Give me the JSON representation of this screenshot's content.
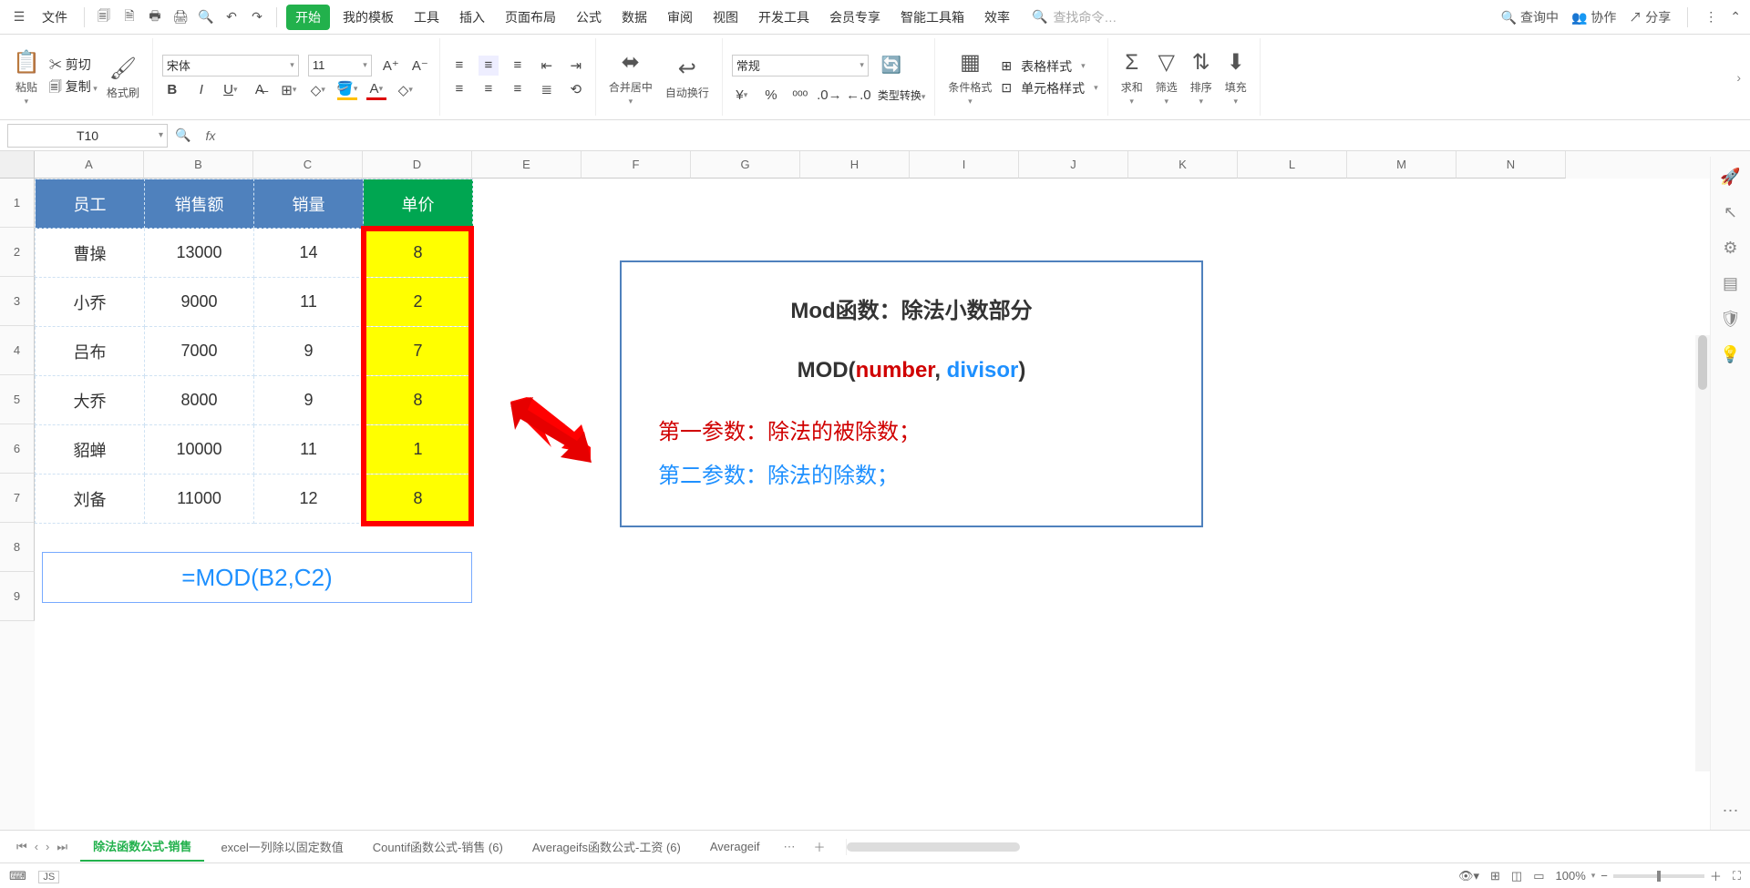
{
  "menu": {
    "file": "文件",
    "tabs": [
      "开始",
      "我的模板",
      "工具",
      "插入",
      "页面布局",
      "公式",
      "数据",
      "审阅",
      "视图",
      "开发工具",
      "会员专享",
      "智能工具箱",
      "效率"
    ],
    "search_placeholder": "查找命令…",
    "right": {
      "query": "查询中",
      "collab": "协作",
      "share": "分享"
    }
  },
  "ribbon": {
    "paste": "粘贴",
    "cut": "剪切",
    "copy": "复制",
    "format_painter": "格式刷",
    "font": "宋体",
    "font_size": "11",
    "merge_center": "合并居中",
    "wrap": "自动换行",
    "num_format": "常规",
    "type_convert": "类型转换",
    "cond_fmt": "条件格式",
    "table_style": "表格样式",
    "cell_style": "单元格样式",
    "sum": "求和",
    "filter": "筛选",
    "sort": "排序",
    "fill": "填充"
  },
  "name_box": "T10",
  "col_headers": [
    "A",
    "B",
    "C",
    "D",
    "E",
    "F",
    "G",
    "H",
    "I",
    "J",
    "K",
    "L",
    "M",
    "N"
  ],
  "table": {
    "headers": [
      "员工",
      "销售额",
      "销量",
      "单价"
    ],
    "rows": [
      {
        "a": "曹操",
        "b": "13000",
        "c": "14",
        "d": "8"
      },
      {
        "a": "小乔",
        "b": "9000",
        "c": "11",
        "d": "2"
      },
      {
        "a": "吕布",
        "b": "7000",
        "c": "9",
        "d": "7"
      },
      {
        "a": "大乔",
        "b": "8000",
        "c": "9",
        "d": "8"
      },
      {
        "a": "貂蝉",
        "b": "10000",
        "c": "11",
        "d": "1"
      },
      {
        "a": "刘备",
        "b": "11000",
        "c": "12",
        "d": "8"
      }
    ],
    "formula": "=MOD(B2,C2)"
  },
  "annotation": {
    "title": "Mod函数：除法小数部分",
    "syntax_pre": "MOD(",
    "syntax_num": "number",
    "syntax_comma": ", ",
    "syntax_div": "divisor",
    "syntax_post": ")",
    "p1": "第一参数：除法的被除数；",
    "p2": "第二参数：除法的除数；"
  },
  "sheets": {
    "active": "除法函数公式-销售",
    "others": [
      "excel一列除以固定数值",
      "Countif函数公式-销售 (6)",
      "Averageifs函数公式-工资 (6)",
      "Averageif"
    ]
  },
  "status": {
    "zoom": "100%"
  }
}
